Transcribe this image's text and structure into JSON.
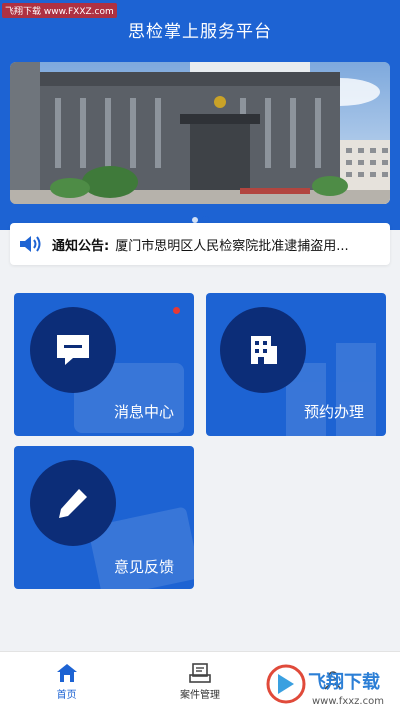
{
  "status_bar": {
    "watermark": "飞翔下载 www.FXXZ.com"
  },
  "header": {
    "title": "思检掌上服务平台"
  },
  "banner": {
    "image": "procuratorate-building",
    "slides": 2,
    "active_slide": 2
  },
  "notice": {
    "label": "通知公告:",
    "text": "厦门市思明区人民检察院批准逮捕盗用...",
    "icon": "speaker-icon"
  },
  "tiles": [
    {
      "label": "消息中心",
      "icon": "message-icon",
      "has_badge": true
    },
    {
      "label": "预约办理",
      "icon": "building-icon",
      "has_badge": false
    },
    {
      "label": "意见反馈",
      "icon": "pen-icon",
      "has_badge": false
    }
  ],
  "bottom_nav": {
    "items": [
      {
        "label": "首页",
        "icon": "home-icon",
        "active": true
      },
      {
        "label": "案件管理",
        "icon": "case-icon",
        "active": false
      },
      {
        "label": "",
        "icon": "user-icon",
        "active": false
      }
    ]
  },
  "watermark": {
    "text": "飞翔下载",
    "url": "www.fxxz.com"
  },
  "colors": {
    "primary": "#1d63d3",
    "circle": "#0c2d78",
    "badge": "#e53935"
  }
}
